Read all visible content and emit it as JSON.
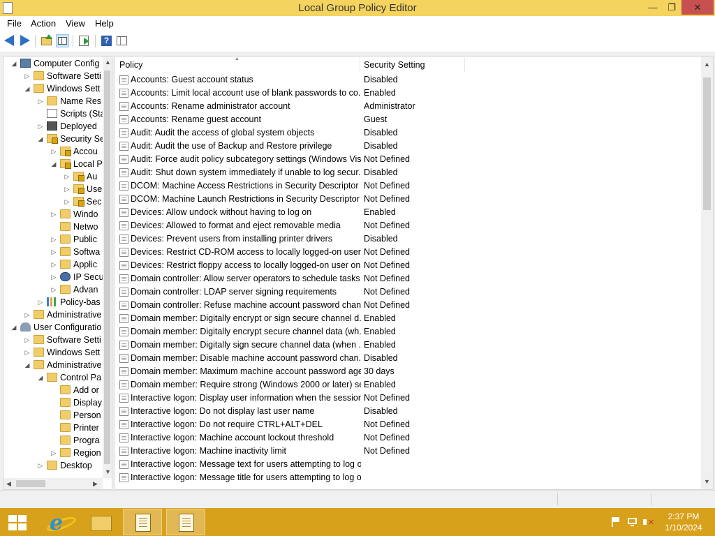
{
  "window": {
    "title": "Local Group Policy Editor"
  },
  "menu": [
    "File",
    "Action",
    "View",
    "Help"
  ],
  "tree": [
    {
      "label": "Computer Config",
      "indent": 0,
      "expander": "open",
      "icon": "computer"
    },
    {
      "label": "Software Setti",
      "indent": 1,
      "expander": "closed",
      "icon": "folder"
    },
    {
      "label": "Windows Sett",
      "indent": 1,
      "expander": "open",
      "icon": "folder"
    },
    {
      "label": "Name Res",
      "indent": 2,
      "expander": "closed",
      "icon": "folder"
    },
    {
      "label": "Scripts (Sta",
      "indent": 2,
      "expander": "none",
      "icon": "script"
    },
    {
      "label": "Deployed",
      "indent": 2,
      "expander": "closed",
      "icon": "printer"
    },
    {
      "label": "Security Se",
      "indent": 2,
      "expander": "open",
      "icon": "locked"
    },
    {
      "label": "Accou",
      "indent": 3,
      "expander": "closed",
      "icon": "locked"
    },
    {
      "label": "Local P",
      "indent": 3,
      "expander": "open",
      "icon": "locked"
    },
    {
      "label": "Au",
      "indent": 4,
      "expander": "closed",
      "icon": "locked"
    },
    {
      "label": "Use",
      "indent": 4,
      "expander": "closed",
      "icon": "locked"
    },
    {
      "label": "Sec",
      "indent": 4,
      "expander": "closed",
      "icon": "locked"
    },
    {
      "label": "Windo",
      "indent": 3,
      "expander": "closed",
      "icon": "folder"
    },
    {
      "label": "Netwo",
      "indent": 3,
      "expander": "none",
      "icon": "folder"
    },
    {
      "label": "Public",
      "indent": 3,
      "expander": "closed",
      "icon": "folder"
    },
    {
      "label": "Softwa",
      "indent": 3,
      "expander": "closed",
      "icon": "folder"
    },
    {
      "label": "Applic",
      "indent": 3,
      "expander": "closed",
      "icon": "folder"
    },
    {
      "label": "IP Secu",
      "indent": 3,
      "expander": "closed",
      "icon": "ipsec"
    },
    {
      "label": "Advan",
      "indent": 3,
      "expander": "closed",
      "icon": "folder"
    },
    {
      "label": "Policy-bas",
      "indent": 2,
      "expander": "closed",
      "icon": "chart"
    },
    {
      "label": "Administrative",
      "indent": 1,
      "expander": "closed",
      "icon": "folder"
    },
    {
      "label": "User Configuratio",
      "indent": 0,
      "expander": "open",
      "icon": "user"
    },
    {
      "label": "Software Setti",
      "indent": 1,
      "expander": "closed",
      "icon": "folder"
    },
    {
      "label": "Windows Sett",
      "indent": 1,
      "expander": "closed",
      "icon": "folder"
    },
    {
      "label": "Administrative",
      "indent": 1,
      "expander": "open",
      "icon": "folder"
    },
    {
      "label": "Control Pa",
      "indent": 2,
      "expander": "open",
      "icon": "folder"
    },
    {
      "label": "Add or",
      "indent": 3,
      "expander": "none",
      "icon": "folder"
    },
    {
      "label": "Display",
      "indent": 3,
      "expander": "none",
      "icon": "folder"
    },
    {
      "label": "Person",
      "indent": 3,
      "expander": "none",
      "icon": "folder"
    },
    {
      "label": "Printer",
      "indent": 3,
      "expander": "none",
      "icon": "folder"
    },
    {
      "label": "Progra",
      "indent": 3,
      "expander": "none",
      "icon": "folder"
    },
    {
      "label": "Region",
      "indent": 3,
      "expander": "closed",
      "icon": "folder"
    },
    {
      "label": "Desktop",
      "indent": 2,
      "expander": "closed",
      "icon": "folder"
    }
  ],
  "list": {
    "headers": {
      "policy": "Policy",
      "setting": "Security Setting"
    },
    "rows": [
      {
        "policy": "Accounts: Guest account status",
        "setting": "Disabled"
      },
      {
        "policy": "Accounts: Limit local account use of blank passwords to co...",
        "setting": "Enabled"
      },
      {
        "policy": "Accounts: Rename administrator account",
        "setting": "Administrator"
      },
      {
        "policy": "Accounts: Rename guest account",
        "setting": "Guest"
      },
      {
        "policy": "Audit: Audit the access of global system objects",
        "setting": "Disabled"
      },
      {
        "policy": "Audit: Audit the use of Backup and Restore privilege",
        "setting": "Disabled"
      },
      {
        "policy": "Audit: Force audit policy subcategory settings (Windows Vis...",
        "setting": "Not Defined"
      },
      {
        "policy": "Audit: Shut down system immediately if unable to log secur...",
        "setting": "Disabled"
      },
      {
        "policy": "DCOM: Machine Access Restrictions in Security Descriptor D...",
        "setting": "Not Defined"
      },
      {
        "policy": "DCOM: Machine Launch Restrictions in Security Descriptor ...",
        "setting": "Not Defined"
      },
      {
        "policy": "Devices: Allow undock without having to log on",
        "setting": "Enabled"
      },
      {
        "policy": "Devices: Allowed to format and eject removable media",
        "setting": "Not Defined"
      },
      {
        "policy": "Devices: Prevent users from installing printer drivers",
        "setting": "Disabled"
      },
      {
        "policy": "Devices: Restrict CD-ROM access to locally logged-on user ...",
        "setting": "Not Defined"
      },
      {
        "policy": "Devices: Restrict floppy access to locally logged-on user only",
        "setting": "Not Defined"
      },
      {
        "policy": "Domain controller: Allow server operators to schedule tasks",
        "setting": "Not Defined"
      },
      {
        "policy": "Domain controller: LDAP server signing requirements",
        "setting": "Not Defined"
      },
      {
        "policy": "Domain controller: Refuse machine account password chan...",
        "setting": "Not Defined"
      },
      {
        "policy": "Domain member: Digitally encrypt or sign secure channel d...",
        "setting": "Enabled"
      },
      {
        "policy": "Domain member: Digitally encrypt secure channel data (wh...",
        "setting": "Enabled"
      },
      {
        "policy": "Domain member: Digitally sign secure channel data (when ...",
        "setting": "Enabled"
      },
      {
        "policy": "Domain member: Disable machine account password chan...",
        "setting": "Disabled"
      },
      {
        "policy": "Domain member: Maximum machine account password age",
        "setting": "30 days"
      },
      {
        "policy": "Domain member: Require strong (Windows 2000 or later) se...",
        "setting": "Enabled"
      },
      {
        "policy": "Interactive logon: Display user information when the session...",
        "setting": "Not Defined"
      },
      {
        "policy": "Interactive logon: Do not display last user name",
        "setting": "Disabled"
      },
      {
        "policy": "Interactive logon: Do not require CTRL+ALT+DEL",
        "setting": "Not Defined"
      },
      {
        "policy": "Interactive logon: Machine account lockout threshold",
        "setting": "Not Defined"
      },
      {
        "policy": "Interactive logon: Machine inactivity limit",
        "setting": "Not Defined"
      },
      {
        "policy": "Interactive logon: Message text for users attempting to log on",
        "setting": ""
      },
      {
        "policy": "Interactive logon: Message title for users attempting to log on",
        "setting": ""
      }
    ]
  },
  "taskbar": {
    "time": "2:37 PM",
    "date": "1/10/2024"
  },
  "colors": {
    "titlebar": "#f4d35e",
    "taskbar": "#d8a11b",
    "close": "#c75050"
  }
}
